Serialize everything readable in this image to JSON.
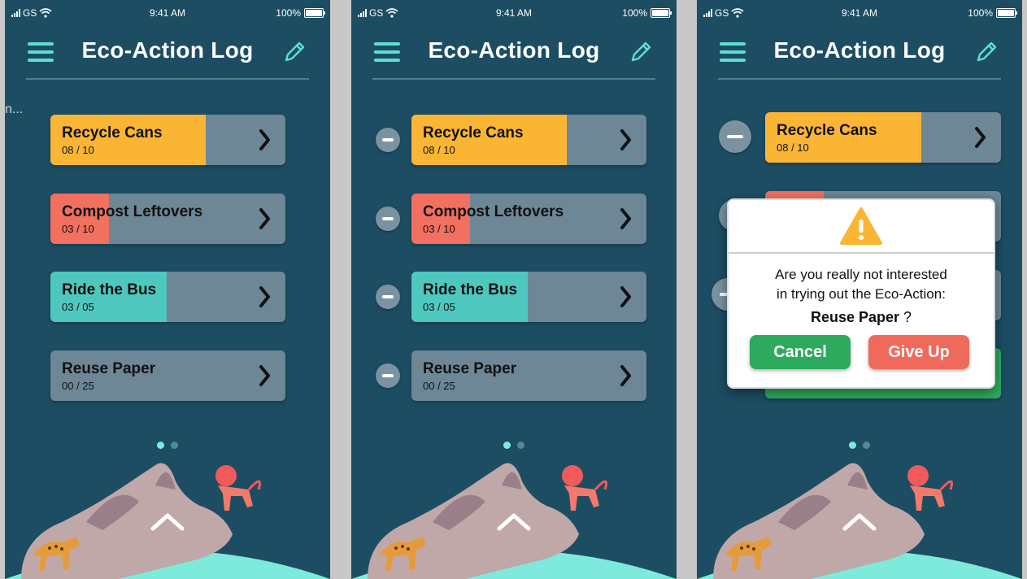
{
  "status": {
    "carrier": "GS",
    "time": "9:41 AM",
    "battery": "100%"
  },
  "header": {
    "title": "Eco-Action Log",
    "menu_icon": "hamburger-icon",
    "edit_icon": "pencil-icon"
  },
  "ghost_text": "n...",
  "actions": [
    {
      "name": "Recycle Cans",
      "count": "08 / 10",
      "progress": 0.8,
      "color": "#fbb534"
    },
    {
      "name": "Compost Leftovers",
      "count": "03 / 10",
      "progress": 0.3,
      "color": "#f2705f"
    },
    {
      "name": "Ride the Bus",
      "count": "03 / 05",
      "progress": 0.6,
      "color": "#4ec8bf"
    },
    {
      "name": "Reuse Paper",
      "count": "00 / 25",
      "progress": 0.0,
      "color": "#6d8796"
    }
  ],
  "pager": {
    "count": 2,
    "active": 0
  },
  "modal": {
    "line1": "Are you really not interested",
    "line2": "in trying out the Eco-Action:",
    "target": "Reuse Paper",
    "suffix": " ?",
    "cancel_label": "Cancel",
    "giveup_label": "Give Up"
  },
  "colors": {
    "background": "#1d4d63",
    "accent": "#5de0cf",
    "track": "#6d8796",
    "cancel": "#2eaa5e",
    "giveup": "#f06a5c"
  }
}
